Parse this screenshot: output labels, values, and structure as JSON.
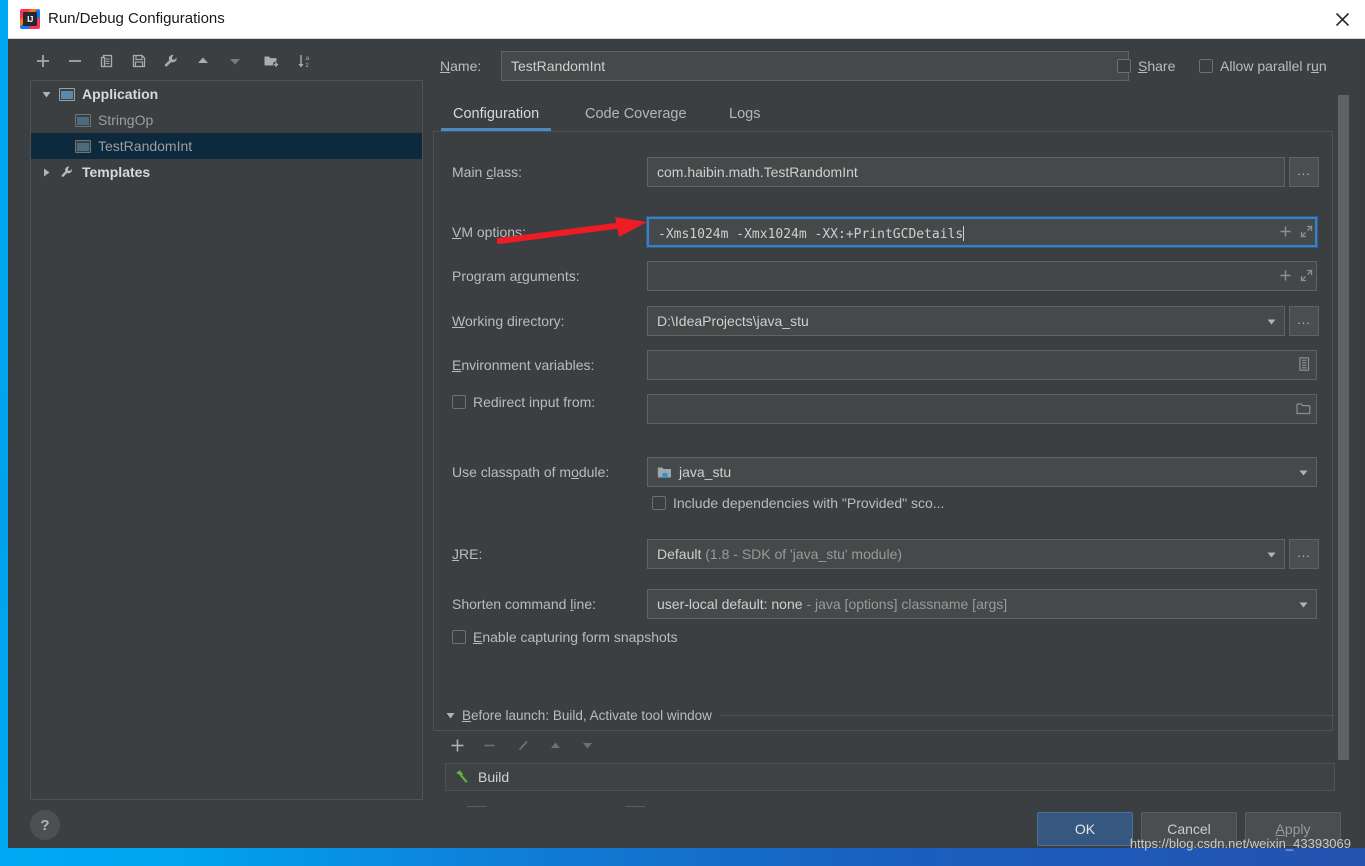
{
  "window": {
    "title": "Run/Debug Configurations",
    "app_icon": "intellij-idea-icon",
    "close_icon": "close-icon"
  },
  "toolbar": {
    "items": [
      {
        "name": "add-configuration-button",
        "icon": "plus-icon",
        "label": "+"
      },
      {
        "name": "remove-configuration-button",
        "icon": "minus-icon",
        "label": "−"
      },
      {
        "name": "copy-configuration-button",
        "icon": "copy-icon",
        "label": "copy"
      },
      {
        "name": "save-configuration-button",
        "icon": "save-icon",
        "label": "save"
      },
      {
        "name": "edit-templates-button",
        "icon": "wrench-icon",
        "label": "templates"
      },
      {
        "name": "move-up-button",
        "icon": "arrow-up-icon",
        "label": "up"
      },
      {
        "name": "move-down-button",
        "icon": "arrow-down-icon",
        "label": "down"
      },
      {
        "name": "new-folder-button",
        "icon": "folder-add-icon",
        "label": "folder"
      },
      {
        "name": "sort-configurations-button",
        "icon": "sort-az-icon",
        "label": "sort"
      }
    ]
  },
  "tree": {
    "nodes": [
      {
        "label": "Application",
        "type": "group",
        "expanded": true,
        "icon": "application-icon"
      },
      {
        "label": "StringOp",
        "type": "leaf",
        "selected": false,
        "icon": "configuration-icon"
      },
      {
        "label": "TestRandomInt",
        "type": "leaf",
        "selected": true,
        "icon": "configuration-icon"
      },
      {
        "label": "Templates",
        "type": "group",
        "expanded": false,
        "icon": "wrench-icon"
      }
    ]
  },
  "form": {
    "name_label": "Name:",
    "name_value": "TestRandomInt",
    "share_label": "Share",
    "share_checked": false,
    "allow_parallel_label": "Allow parallel run",
    "allow_parallel_checked": false,
    "tabs": [
      {
        "label": "Configuration",
        "active": true
      },
      {
        "label": "Code Coverage",
        "active": false
      },
      {
        "label": "Logs",
        "active": false
      }
    ],
    "fields": {
      "main_class_label": "Main class:",
      "main_class_value": "com.haibin.math.TestRandomInt",
      "main_class_browse": "...",
      "vm_options_label": "VM options:",
      "vm_options_value": "-Xms1024m -Xmx1024m -XX:+PrintGCDetails",
      "program_arguments_label": "Program arguments:",
      "program_arguments_value": "",
      "working_directory_label": "Working directory:",
      "working_directory_value": "D:\\IdeaProjects\\java_stu",
      "working_directory_browse": "...",
      "environment_variables_label": "Environment variables:",
      "environment_variables_value": "",
      "redirect_input_label": "Redirect input from:",
      "redirect_input_checked": false,
      "redirect_input_value": "",
      "use_classpath_label": "Use classpath of module:",
      "use_classpath_value": "java_stu",
      "include_dependencies_label": "Include dependencies with \"Provided\" sco...",
      "include_dependencies_checked": false,
      "jre_label": "JRE:",
      "jre_value": "Default",
      "jre_value_detail": "(1.8 - SDK of 'java_stu' module)",
      "jre_browse": "...",
      "shorten_label": "Shorten command line:",
      "shorten_value": "user-local default: none",
      "shorten_value_detail": "- java [options] classname [args]",
      "enable_snapshots_label": "Enable capturing form snapshots",
      "enable_snapshots_checked": false
    }
  },
  "before_launch": {
    "title": "Before launch: Build, Activate tool window",
    "expanded": true,
    "toolbar": [
      {
        "name": "before-launch-add-button",
        "icon": "plus-icon"
      },
      {
        "name": "before-launch-remove-button",
        "icon": "minus-icon"
      },
      {
        "name": "before-launch-edit-button",
        "icon": "pencil-icon"
      },
      {
        "name": "before-launch-up-button",
        "icon": "arrow-up-icon"
      },
      {
        "name": "before-launch-down-button",
        "icon": "arrow-down-icon"
      }
    ],
    "items": [
      {
        "label": "Build",
        "icon": "hammer-icon"
      }
    ]
  },
  "footer": {
    "help_label": "?",
    "ok_label": "OK",
    "cancel_label": "Cancel",
    "apply_label": "Apply"
  },
  "watermark": "https://blog.csdn.net/weixin_43393069",
  "annotation": {
    "arrow_color": "#ee1c25",
    "points_to": "vm-options-field"
  },
  "colors": {
    "window_bg": "#3c3f41",
    "field_bg": "#45494a",
    "accent": "#4a88c7",
    "selection": "#0d293e",
    "ok_button": "#365880",
    "frame_blue": "#1a62c4",
    "left_strip": "#00a8f3"
  }
}
